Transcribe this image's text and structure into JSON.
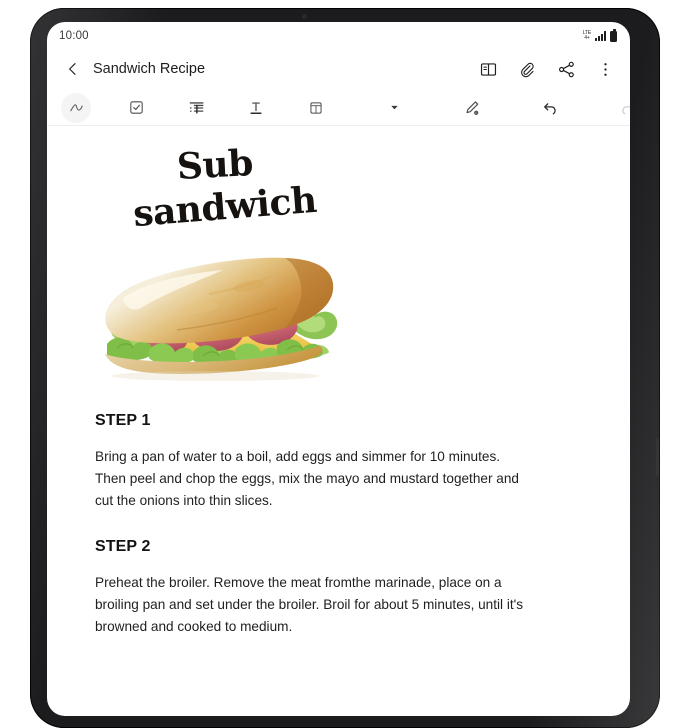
{
  "device": {
    "camera_icon": "front-camera-dot",
    "side_button": "power-button"
  },
  "status_bar": {
    "time": "10:00",
    "network_label_top": "LTE",
    "network_label_bottom": "4+",
    "icons": [
      "lte-icon",
      "signal-bars-icon",
      "battery-icon"
    ],
    "signal_bars": 4,
    "battery_full": true
  },
  "header": {
    "back_icon": "chevron-left-icon",
    "title": "Sandwich Recipe",
    "actions": [
      {
        "name": "view-mode-icon",
        "label": "View mode"
      },
      {
        "name": "attach-icon",
        "label": "Attach"
      },
      {
        "name": "share-icon",
        "label": "Share"
      },
      {
        "name": "more-options-icon",
        "label": "More options"
      }
    ]
  },
  "toolbar": {
    "items": [
      {
        "name": "pen-tool-icon",
        "label": "Pen",
        "active": true
      },
      {
        "name": "checkbox-icon",
        "label": "Checklist",
        "active": false
      },
      {
        "name": "paragraph-format-icon",
        "label": "Paragraph style",
        "active": false
      },
      {
        "name": "text-format-icon",
        "label": "Text format",
        "active": false
      },
      {
        "name": "insert-table-icon",
        "label": "Insert",
        "active": false
      },
      {
        "name": "chevron-down-icon",
        "label": "More tools",
        "active": false
      },
      {
        "name": "pen-settings-icon",
        "label": "Pen settings",
        "active": false
      },
      {
        "name": "undo-icon",
        "label": "Undo",
        "active": false,
        "enabled": true
      },
      {
        "name": "redo-icon",
        "label": "Redo",
        "active": false,
        "enabled": false
      }
    ]
  },
  "note": {
    "heading_line_1": "Sub",
    "heading_line_2": "sandwich",
    "illustration": "sub-sandwich-watercolor",
    "steps": [
      {
        "heading": "STEP 1",
        "body": "Bring a pan of water to a boil, add eggs and simmer for 10 minutes. Then peel and chop the eggs, mix the mayo and mustard together and cut the onions into thin slices."
      },
      {
        "heading": "STEP 2",
        "body": "Preheat the broiler. Remove the meat fromthe marinade, place on a broiling pan and set under the broiler. Broil for about 5 minutes, until it's browned and cooked to medium."
      }
    ]
  },
  "colors": {
    "bezel": "#1c1c1e",
    "screen_bg": "#ffffff",
    "text_primary": "#1a1a1a",
    "toolbar_divider": "#eceff0",
    "active_tool_bg": "#f4f4f4",
    "disabled_icon": "#cfcfcf",
    "bread": "#d99b4a",
    "lettuce": "#7fbf48",
    "ham": "#d9737d",
    "cheese": "#f2cf4e"
  }
}
